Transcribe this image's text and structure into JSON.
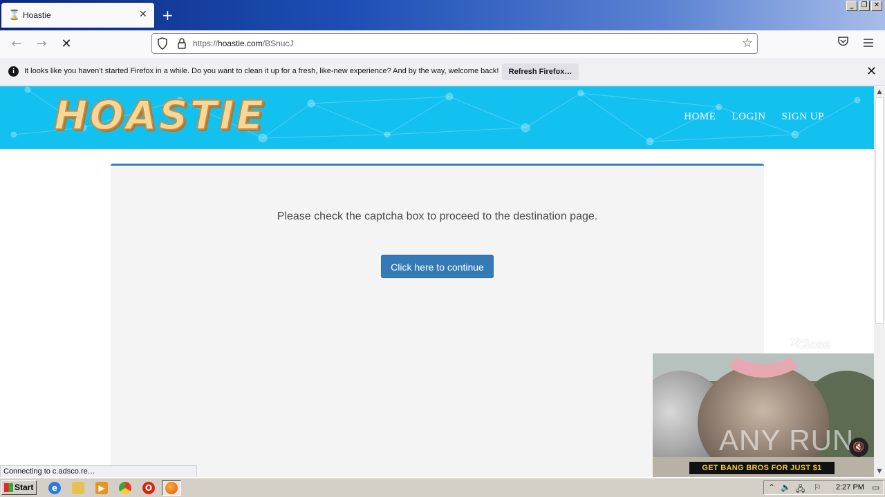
{
  "browser": {
    "tab": {
      "title": "Hoastie",
      "favicon": "hourglass-icon"
    },
    "url": {
      "prefix": "https://",
      "host": "hoastie.com",
      "path": "/BSnucJ"
    },
    "notification": {
      "message": "It looks like you haven’t started Firefox in a while. Do you want to clean it up for a fresh, like-new experience? And by the way, welcome back!",
      "button": "Refresh Firefox…"
    },
    "status": "Connecting to c.adsco.re…"
  },
  "site": {
    "logo": "HOASTIE",
    "nav": [
      "HOME",
      "LOGIN",
      "SIGN UP"
    ],
    "prompt": "Please check the captcha box to proceed to the destination page.",
    "continue_button": "Click here to continue",
    "colors": {
      "header": "#13c1f1",
      "button": "#337ab7",
      "card_border": "#2f7ad2"
    }
  },
  "ad": {
    "close_label": "Close ad",
    "banner": "GET BANG BROS FOR JUST $1",
    "watermark": "ANY RUN"
  },
  "taskbar": {
    "start": "Start",
    "clock": "2:27 PM"
  }
}
